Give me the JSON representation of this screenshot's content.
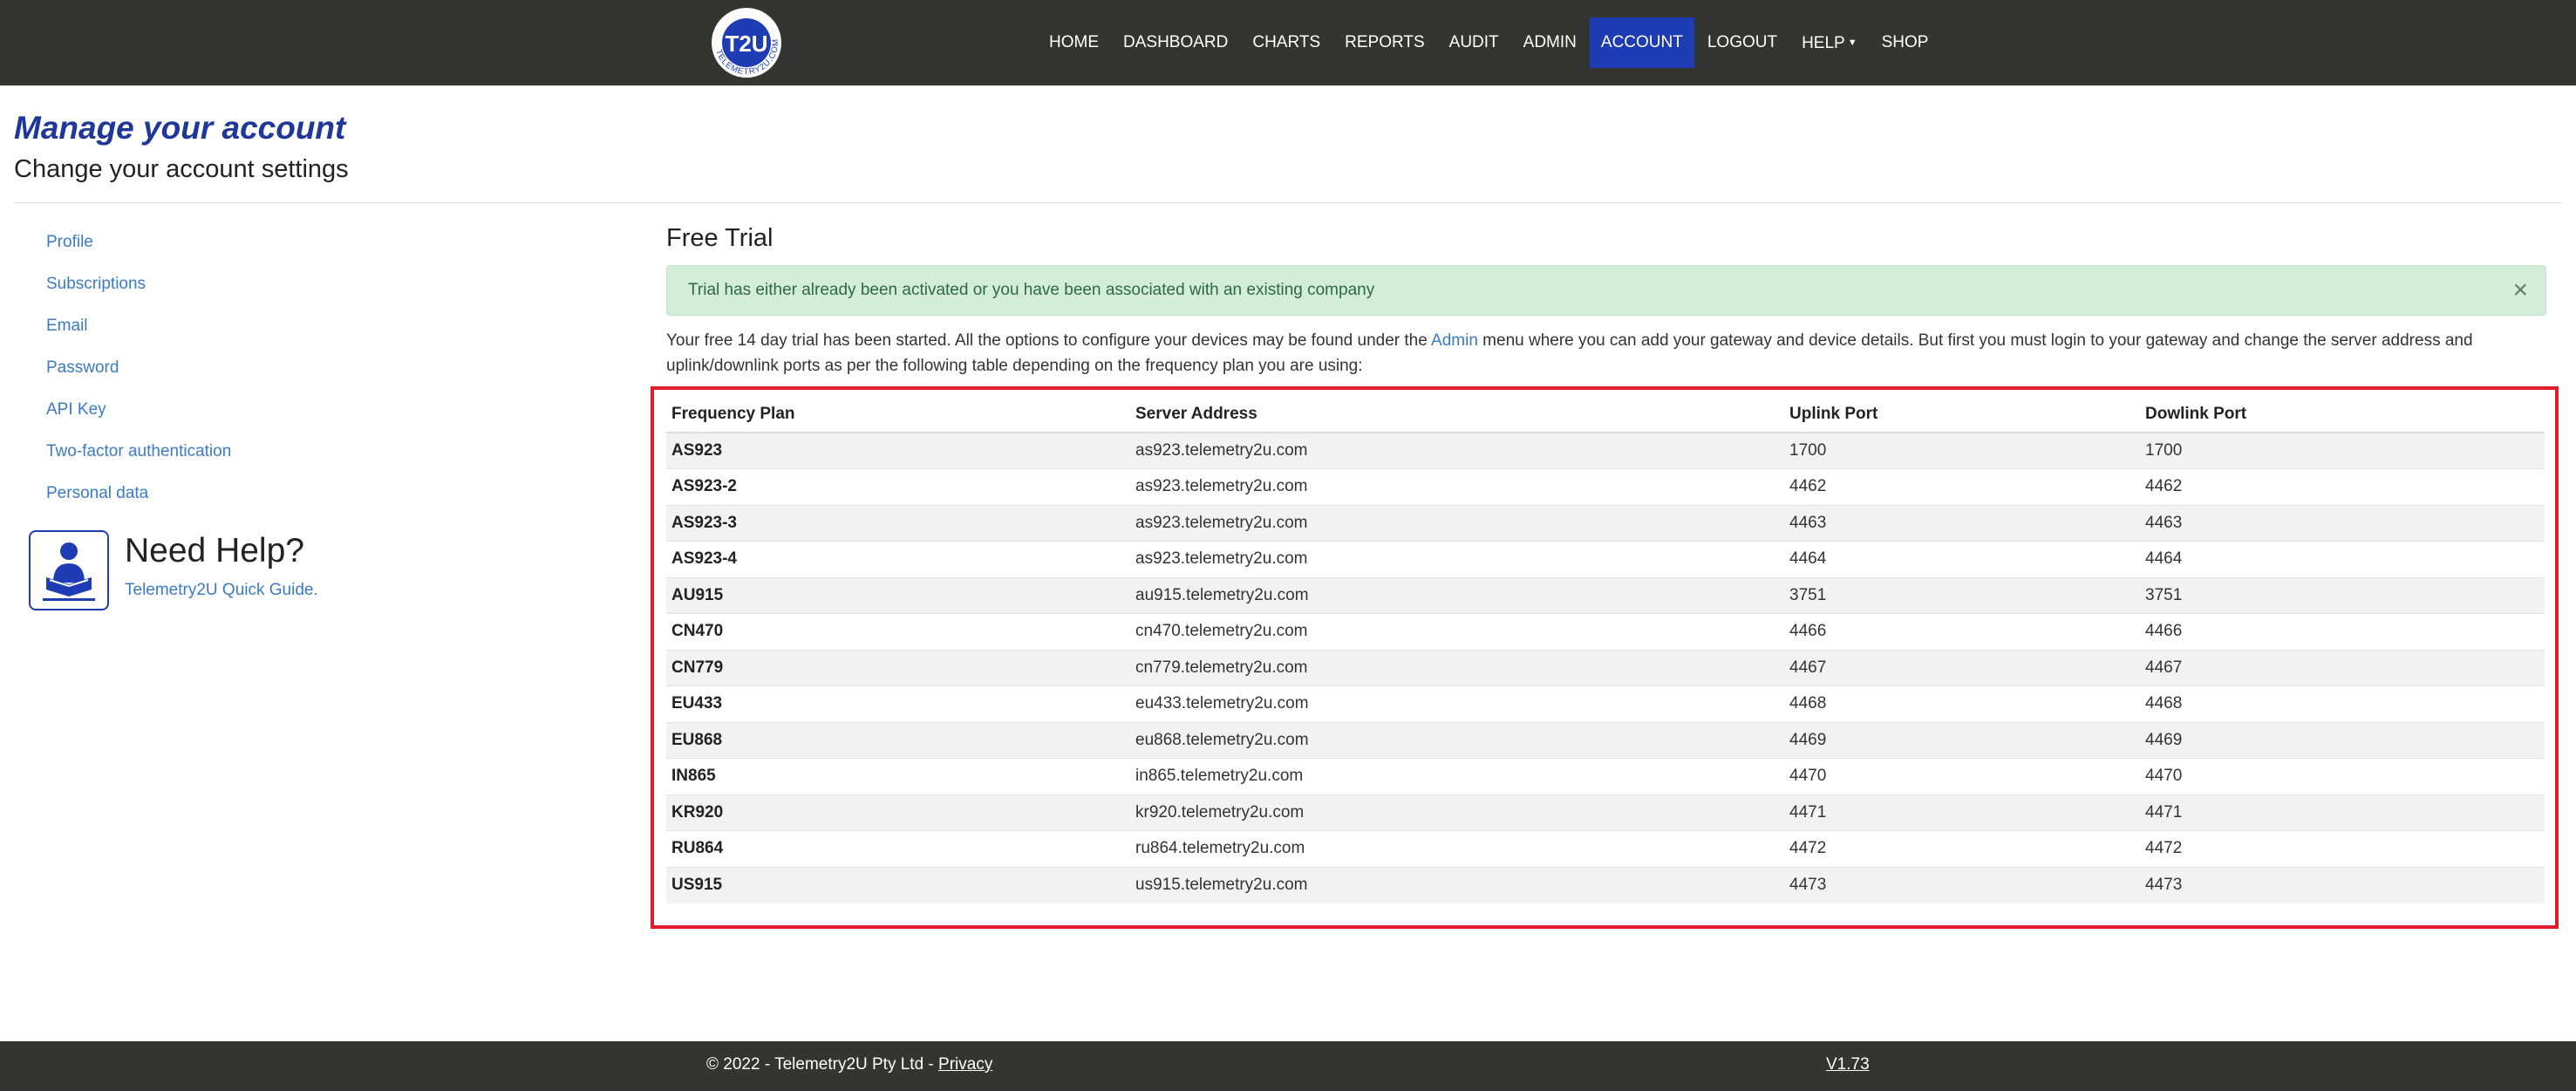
{
  "brand": {
    "logo_text": "T2U",
    "logo_ring_text": "TELEMETRY2U.COM",
    "primary_color": "#1e3cb4",
    "navbar_color": "#343433",
    "highlight_border_color": "#e21b2a"
  },
  "nav": {
    "items": [
      {
        "label": "HOME"
      },
      {
        "label": "DASHBOARD"
      },
      {
        "label": "CHARTS"
      },
      {
        "label": "REPORTS"
      },
      {
        "label": "AUDIT"
      },
      {
        "label": "ADMIN"
      },
      {
        "label": "ACCOUNT",
        "active": true
      },
      {
        "label": "LOGOUT"
      },
      {
        "label": "HELP",
        "dropdown": true
      },
      {
        "label": "SHOP"
      }
    ]
  },
  "header": {
    "title": "Manage your account",
    "subtitle": "Change your account settings"
  },
  "sidebar": {
    "items": [
      {
        "label": "Profile"
      },
      {
        "label": "Subscriptions"
      },
      {
        "label": "Email"
      },
      {
        "label": "Password"
      },
      {
        "label": "API Key"
      },
      {
        "label": "Two-factor authentication"
      },
      {
        "label": "Personal data"
      }
    ],
    "help": {
      "icon": "reading-person-icon",
      "title": "Need Help?",
      "link": "Telemetry2U Quick Guide."
    }
  },
  "main": {
    "section_title": "Free Trial",
    "alert": {
      "message": "Trial has either already been activated or you have been associated with an existing company",
      "close": "×"
    },
    "intro": {
      "before_link": "Your free 14 day trial has been started. All the options to configure your devices may be found under the ",
      "link": "Admin",
      "after_link": " menu where you can add your gateway and device details. But first you must login to your gateway and change the server address and uplink/downlink ports as per the following table depending on the frequency plan you are using:"
    },
    "table": {
      "headers": [
        "Frequency Plan",
        "Server Address",
        "Uplink Port",
        "Dowlink Port"
      ],
      "rows": [
        [
          "AS923",
          "as923.telemetry2u.com",
          "1700",
          "1700"
        ],
        [
          "AS923-2",
          "as923.telemetry2u.com",
          "4462",
          "4462"
        ],
        [
          "AS923-3",
          "as923.telemetry2u.com",
          "4463",
          "4463"
        ],
        [
          "AS923-4",
          "as923.telemetry2u.com",
          "4464",
          "4464"
        ],
        [
          "AU915",
          "au915.telemetry2u.com",
          "3751",
          "3751"
        ],
        [
          "CN470",
          "cn470.telemetry2u.com",
          "4466",
          "4466"
        ],
        [
          "CN779",
          "cn779.telemetry2u.com",
          "4467",
          "4467"
        ],
        [
          "EU433",
          "eu433.telemetry2u.com",
          "4468",
          "4468"
        ],
        [
          "EU868",
          "eu868.telemetry2u.com",
          "4469",
          "4469"
        ],
        [
          "IN865",
          "in865.telemetry2u.com",
          "4470",
          "4470"
        ],
        [
          "KR920",
          "kr920.telemetry2u.com",
          "4471",
          "4471"
        ],
        [
          "RU864",
          "ru864.telemetry2u.com",
          "4472",
          "4472"
        ],
        [
          "US915",
          "us915.telemetry2u.com",
          "4473",
          "4473"
        ]
      ]
    }
  },
  "footer": {
    "copyright": "© 2022 - Telemetry2U Pty Ltd - ",
    "privacy": "Privacy",
    "version": "V1.73"
  }
}
